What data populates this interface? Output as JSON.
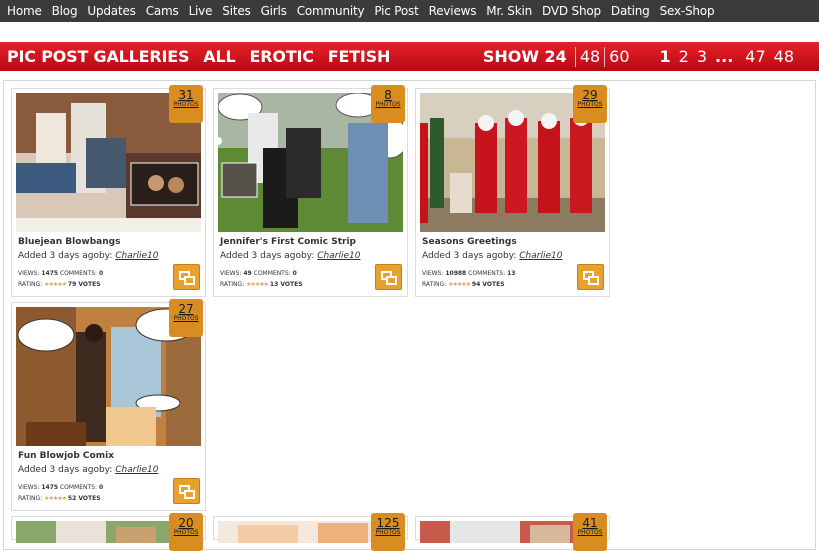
{
  "nav": {
    "items": [
      {
        "label": "Home"
      },
      {
        "label": "Blog"
      },
      {
        "label": "Updates"
      },
      {
        "label": "Cams"
      },
      {
        "label": "Live"
      },
      {
        "label": "Sites"
      },
      {
        "label": "Girls"
      },
      {
        "label": "Community"
      },
      {
        "label": "Pic Post"
      },
      {
        "label": "Reviews"
      },
      {
        "label": "Mr. Skin"
      },
      {
        "label": "DVD Shop"
      },
      {
        "label": "Dating"
      },
      {
        "label": "Sex-Shop"
      }
    ]
  },
  "bar": {
    "title": "PIC POST GALLERIES",
    "categories": [
      {
        "label": "ALL"
      },
      {
        "label": "EROTIC"
      },
      {
        "label": "FETISH"
      }
    ],
    "show_label": "SHOW 24",
    "show_options": [
      {
        "label": "48"
      },
      {
        "label": "60"
      }
    ],
    "pages": [
      {
        "label": "1"
      },
      {
        "label": "2"
      },
      {
        "label": "3"
      }
    ],
    "ellipsis": "...",
    "last_pages": [
      {
        "label": "47"
      },
      {
        "label": "48"
      }
    ]
  },
  "galleries": [
    {
      "title": "Bluejean Blowbangs",
      "count": "31",
      "count_label": "PHOTOS",
      "added": "Added 3 days agoby:",
      "author": "Charlie10",
      "views_label": "VIEWS:",
      "views": "1475",
      "comments_label": "COMMENTS:",
      "comments": "0",
      "rating_label": "RATING:",
      "stars": "★★★★★",
      "votes": "79 VOTES"
    },
    {
      "title": "Jennifer's First Comic Strip",
      "count": "8",
      "count_label": "PHOTOS",
      "added": "Added 3 days agoby:",
      "author": "Charlie10",
      "views_label": "VIEWS:",
      "views": "49",
      "comments_label": "COMMENTS:",
      "comments": "0",
      "rating_label": "RATING:",
      "stars": "★★★★★",
      "votes": "13 VOTES"
    },
    {
      "title": "Seasons Greetings",
      "count": "29",
      "count_label": "PHOTOS",
      "added": "Added 3 days agoby:",
      "author": "Charlie10",
      "views_label": "VIEWS:",
      "views": "10988",
      "comments_label": "COMMENTS:",
      "comments": "13",
      "rating_label": "RATING:",
      "stars": "★★★★★",
      "votes": "94 VOTES"
    },
    {
      "title": "Fun Blowjob Comix",
      "count": "27",
      "count_label": "PHOTOS",
      "added": "Added 3 days agoby:",
      "author": "Charlie10",
      "views_label": "VIEWS:",
      "views": "1475",
      "comments_label": "COMMENTS:",
      "comments": "0",
      "rating_label": "RATING:",
      "stars": "★★★★★",
      "votes": "52 VOTES"
    }
  ],
  "partial_galleries": [
    {
      "count": "20",
      "count_label": "PHOTOS"
    },
    {
      "count": "125",
      "count_label": "PHOTOS"
    },
    {
      "count": "41",
      "count_label": "PHOTOS"
    }
  ],
  "colors": {
    "nav_bg": "#3b3b3b",
    "bar_red": "#d0141c",
    "badge_orange": "#d98c1f"
  }
}
